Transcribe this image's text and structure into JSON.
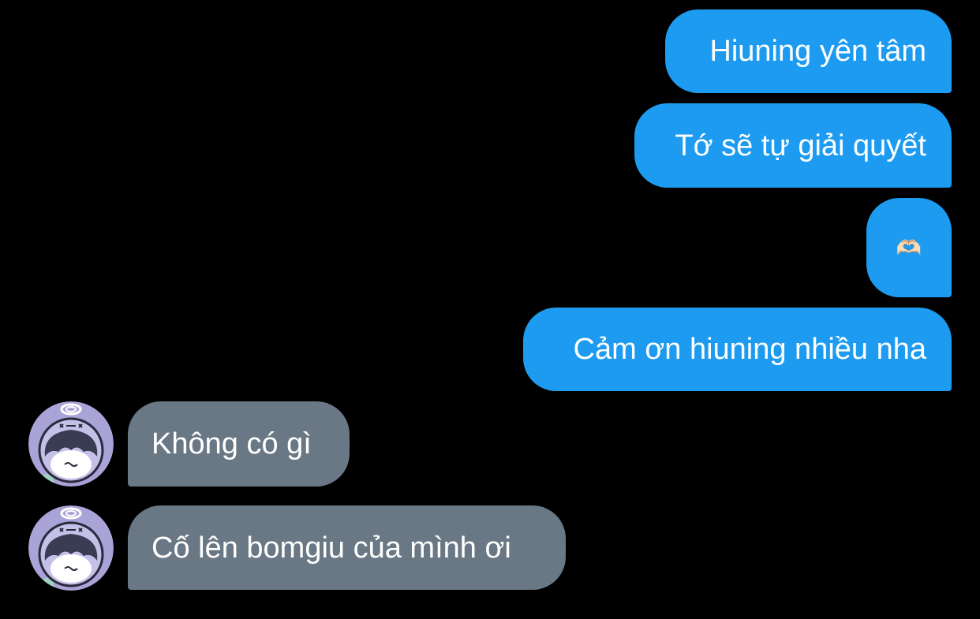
{
  "colors": {
    "background": "#000000",
    "outgoing_bubble": "#1d9bf0",
    "incoming_bubble": "#6a7885",
    "text": "#ffffff",
    "avatar_bg": "#a9a3d8"
  },
  "messages": [
    {
      "direction": "outgoing",
      "text": "Hiuning yên tâm"
    },
    {
      "direction": "outgoing",
      "text": "Tớ sẽ tự giải quyết"
    },
    {
      "direction": "outgoing",
      "text": "🫶🏻",
      "icon": "heart-hands-emoji"
    },
    {
      "direction": "outgoing",
      "text": "Cảm ơn hiuning nhiều nha"
    },
    {
      "direction": "incoming",
      "text": "Không có gì",
      "avatar": "angel-character-avatar"
    },
    {
      "direction": "incoming",
      "text": "Cố lên bomgiu của mình ơi",
      "avatar": "angel-character-avatar"
    }
  ]
}
